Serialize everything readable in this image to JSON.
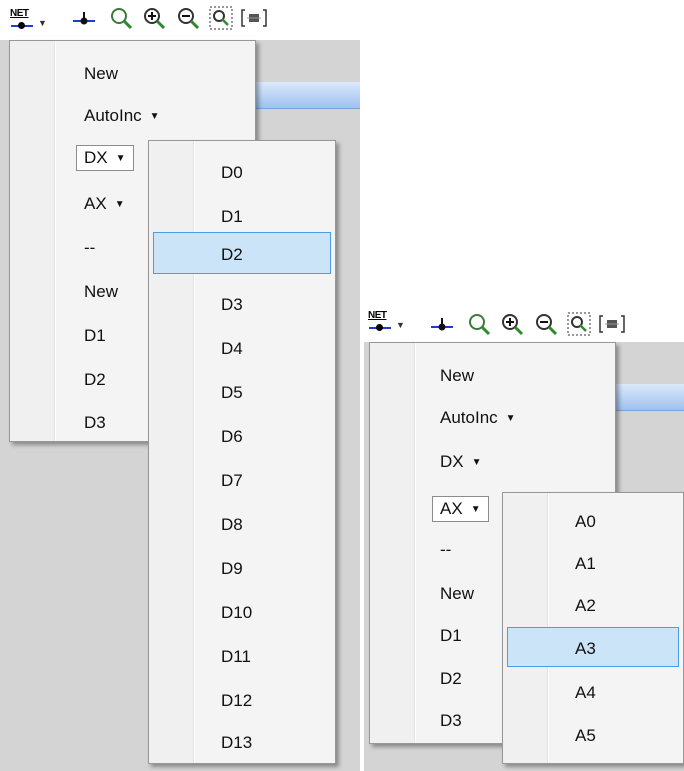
{
  "toolbar": {
    "net_label": "NET",
    "icons": [
      "junction-icon",
      "zoom-icon",
      "zoom-in-icon",
      "zoom-out-icon",
      "zoom-fit-icon",
      "component-icon"
    ]
  },
  "main_menu": {
    "items": [
      {
        "label": "New"
      },
      {
        "label": "AutoInc"
      },
      {
        "label": "DX"
      },
      {
        "label": "AX"
      },
      {
        "label": "--"
      },
      {
        "label": "New"
      },
      {
        "label": "D1"
      },
      {
        "label": "D2"
      },
      {
        "label": "D3"
      }
    ]
  },
  "dx_submenu": {
    "items": [
      "D0",
      "D1",
      "D2",
      "D3",
      "D4",
      "D5",
      "D6",
      "D7",
      "D8",
      "D9",
      "D10",
      "D11",
      "D12",
      "D13"
    ],
    "selected": "D2"
  },
  "ax_submenu": {
    "items": [
      "A0",
      "A1",
      "A2",
      "A3",
      "A4",
      "A5"
    ],
    "selected": "A3"
  },
  "colors": {
    "menu_bg": "#f4f4f4",
    "selection_bg": "#cce4f7",
    "selection_border": "#4a9de6",
    "canvas_grey": "#d4d4d4"
  }
}
